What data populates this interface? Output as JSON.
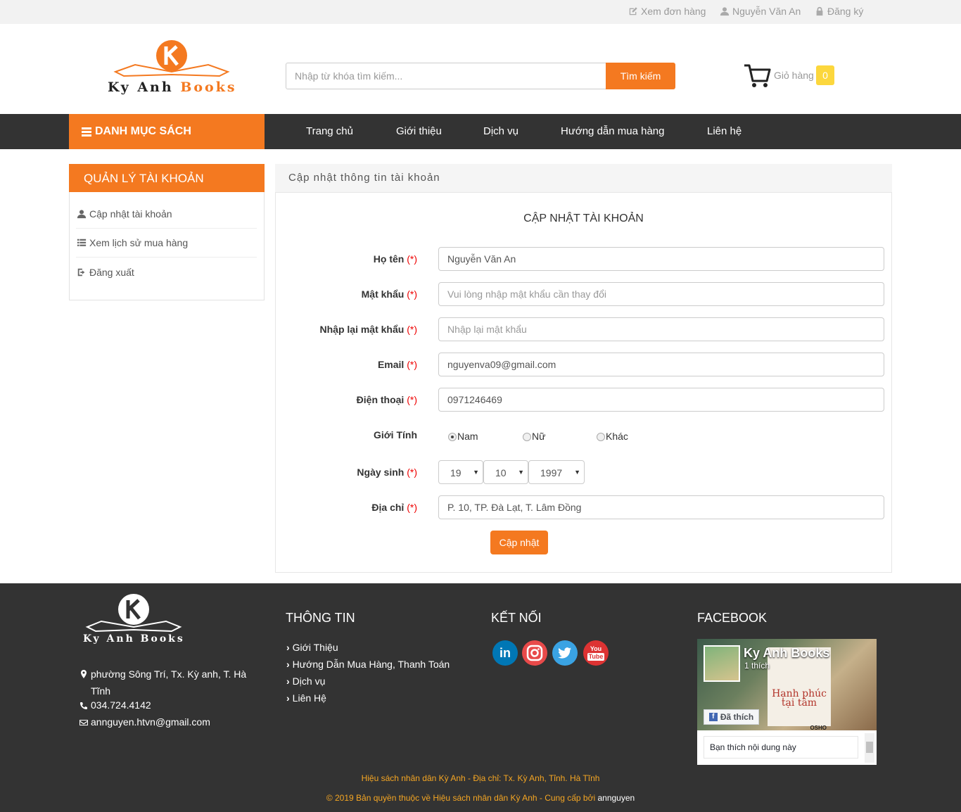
{
  "topbar": {
    "orders": "Xem đơn hàng",
    "user": "Nguyễn Văn An",
    "register": "Đăng ký"
  },
  "logo": {
    "part1": "Ky Anh",
    "part2": "Books"
  },
  "search": {
    "placeholder": "Nhập từ khóa tìm kiếm...",
    "button": "Tìm kiếm"
  },
  "cart": {
    "label": "Giỏ hàng",
    "count": "0"
  },
  "nav": {
    "category": "DANH MỤC SÁCH",
    "items": [
      "Trang chủ",
      "Giới thiệu",
      "Dịch vụ",
      "Hướng dẫn mua hàng",
      "Liên hệ"
    ]
  },
  "sidebar": {
    "title": "QUẢN LÝ TÀI KHOẢN",
    "items": [
      "Cập nhật tài khoản",
      "Xem lịch sử mua hàng",
      "Đăng xuất"
    ]
  },
  "panel": {
    "heading": "Cập nhật thông tin tài khoản",
    "form_title": "CẬP NHẬT TÀI KHOẢN"
  },
  "form": {
    "required_mark": "(*)",
    "name_label": "Họ tên",
    "name_value": "Nguyễn Văn An",
    "password_label": "Mật khẩu",
    "password_placeholder": "Vui lòng nhập mật khẩu cần thay đổi",
    "repassword_label": "Nhập lại mật khẩu",
    "repassword_placeholder": "Nhập lại mật khẩu",
    "email_label": "Email",
    "email_value": "nguyenva09@gmail.com",
    "phone_label": "Điện thoại",
    "phone_value": "0971246469",
    "gender_label": "Giới Tính",
    "gender_options": [
      "Nam",
      "Nữ",
      "Khác"
    ],
    "gender_selected": "Nam",
    "dob_label": "Ngày sinh",
    "dob_day": "19",
    "dob_month": "10",
    "dob_year": "1997",
    "address_label": "Địa chỉ",
    "address_value": "P. 10, TP. Đà Lạt, T. Lâm Đồng",
    "submit": "Cập nhật"
  },
  "footer": {
    "logo": "Ky Anh Books",
    "address": "phường Sông Trí, Tx. Kỳ anh, T. Hà Tĩnh",
    "phone": "034.724.4142",
    "email": "annguyen.htvn@gmail.com",
    "info_title": "THÔNG TIN",
    "info_links": [
      "Giới Thiệu",
      "Hướng Dẫn Mua Hàng, Thanh Toán",
      "Dịch vụ",
      "Liên Hệ"
    ],
    "connect_title": "KẾT NỐI",
    "facebook_title": "FACEBOOK",
    "fb_page_name": "Ky Anh Books",
    "fb_likes": "1 thích",
    "fb_liked_btn": "Đã thích",
    "fb_post": "Bạn thích nội dung này",
    "fb_book_title": "Hạnh phúc tại tâm",
    "fb_book_author": "OSHO",
    "copyright1": "Hiệu sách nhân dân Kỳ Anh - Địa chỉ: Tx. Kỳ Anh, Tỉnh. Hà Tĩnh",
    "copyright2": "© 2019 Bản quyền thuộc về Hiệu sách nhân dân Kỳ Anh - Cung cấp bởi",
    "copyright_author": "annguyen"
  },
  "colors": {
    "accent": "#f47920",
    "dark": "#333333",
    "badge": "#fcd73d"
  },
  "icons": [
    "edit-icon",
    "user-icon",
    "lock-icon",
    "cart-icon",
    "bars-icon",
    "list-icon",
    "logout-icon",
    "map-marker-icon",
    "phone-icon",
    "envelope-icon",
    "linkedin-icon",
    "instagram-icon",
    "twitter-icon",
    "youtube-icon"
  ]
}
